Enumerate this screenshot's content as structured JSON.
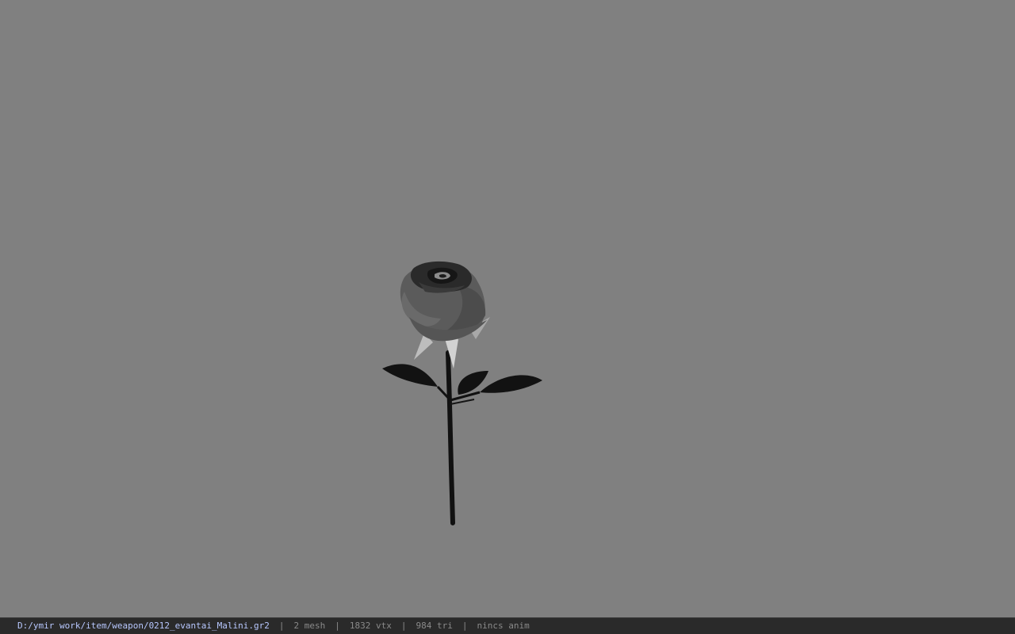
{
  "viewer": {
    "background_color": "#808080",
    "model_icon": "rose-model"
  },
  "statusbar": {
    "file_path": "D:/ymir work/item/weapon/0212_evantai_Malini.gr2",
    "mesh_count": "2 mesh",
    "vertex_count": "1832 vtx",
    "triangle_count": "984 tri",
    "anim_status": "nincs anim",
    "separator": "|",
    "path_color": "#b8c8ff",
    "text_color": "#8a8a8a"
  }
}
